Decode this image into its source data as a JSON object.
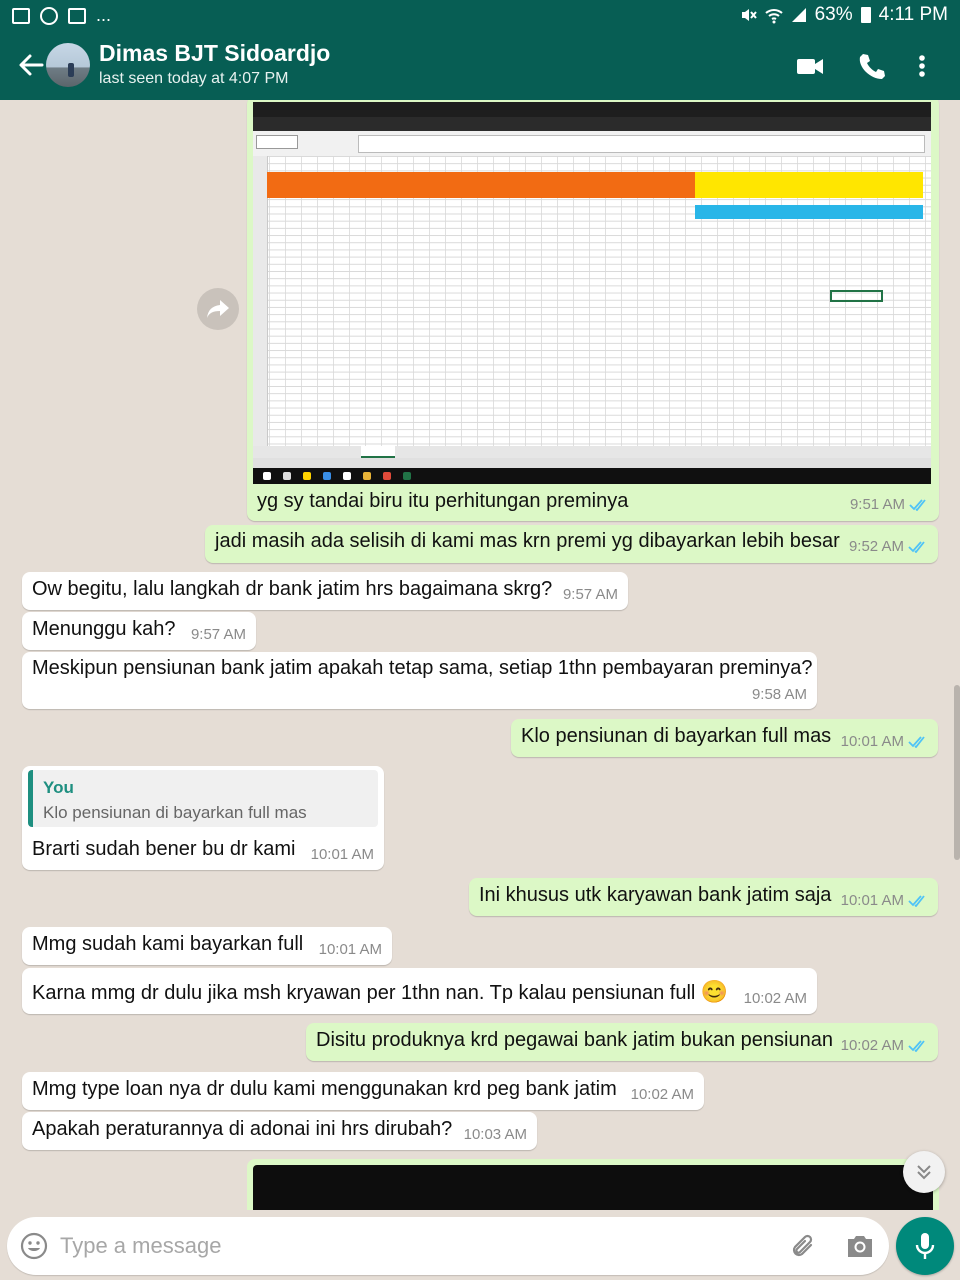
{
  "status_bar": {
    "battery": "63%",
    "time": "4:11 PM",
    "overflow": "..."
  },
  "header": {
    "contact_name": "Dimas BJT Sidoardjo",
    "last_seen": "last seen today at 4:07 PM",
    "icons": [
      "back-arrow-icon",
      "video-call-icon",
      "phone-icon",
      "more-vert-icon"
    ]
  },
  "chat": {
    "image_message": {
      "caption": "yg sy tandai biru itu perhitungan preminya",
      "time": "9:51 AM"
    },
    "messages": [
      {
        "dir": "out",
        "text": "jadi masih ada selisih di kami mas krn premi yg dibayarkan lebih besar",
        "time": "9:52 AM"
      },
      {
        "dir": "in",
        "text": "Ow begitu, lalu langkah dr bank jatim hrs bagaimana skrg?",
        "time": "9:57 AM"
      },
      {
        "dir": "in",
        "text": "Menunggu kah?",
        "time": "9:57 AM"
      },
      {
        "dir": "in",
        "text": "Meskipun pensiunan bank jatim apakah tetap sama, setiap 1thn pembayaran preminya?",
        "time": "9:58 AM"
      },
      {
        "dir": "out",
        "text": "Klo pensiunan di bayarkan full mas",
        "time": "10:01 AM"
      },
      {
        "dir": "in",
        "text": "Brarti sudah bener bu dr kami",
        "time": "10:01 AM",
        "quote": {
          "author": "You",
          "text": "Klo pensiunan di bayarkan full mas"
        }
      },
      {
        "dir": "out",
        "text": "Ini khusus utk karyawan bank jatim saja",
        "time": "10:01 AM"
      },
      {
        "dir": "in",
        "text": "Mmg sudah kami bayarkan full",
        "time": "10:01 AM"
      },
      {
        "dir": "in",
        "text": "Karna mmg dr dulu jika msh kryawan per 1thn nan. Tp kalau pensiunan full",
        "emoji": "😊",
        "time": "10:02 AM"
      },
      {
        "dir": "out",
        "text": "Disitu produknya krd pegawai bank jatim bukan pensiunan",
        "time": "10:02 AM"
      },
      {
        "dir": "in",
        "text": "Mmg type loan nya dr dulu kami menggunakan krd peg bank jatim",
        "time": "10:02 AM"
      },
      {
        "dir": "in",
        "text": "Apakah peraturannya di adonai ini hrs dirubah?",
        "time": "10:03 AM"
      }
    ]
  },
  "input": {
    "placeholder": "Type a message"
  },
  "colors": {
    "header": "#075e54",
    "outgoing_bubble": "#dcf8c6",
    "incoming_bubble": "#ffffff",
    "chat_background": "#e5ddd5",
    "tick_read": "#4fc3f7",
    "mic_button": "#00897b"
  }
}
